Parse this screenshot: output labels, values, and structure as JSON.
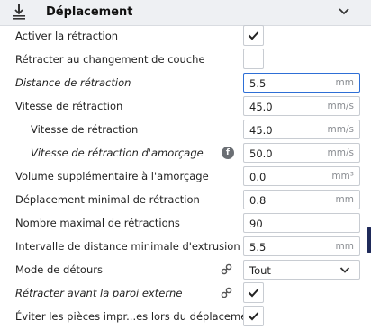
{
  "section": {
    "title": "Déplacement"
  },
  "rows": [
    {
      "label": "Activer la rétraction",
      "checked": true
    },
    {
      "label": "Rétracter au changement de couche",
      "checked": false
    },
    {
      "label": "Distance de rétraction",
      "value": "5.5",
      "unit": "mm"
    },
    {
      "label": "Vitesse de rétraction",
      "value": "45.0",
      "unit": "mm/s"
    },
    {
      "label": "Vitesse de rétraction",
      "value": "45.0",
      "unit": "mm/s"
    },
    {
      "label": "Vitesse de rétraction d'amorçage",
      "value": "50.0",
      "unit": "mm/s"
    },
    {
      "label": "Volume supplémentaire à l'amorçage",
      "value": "0.0",
      "unit": "mm³"
    },
    {
      "label": "Déplacement minimal de rétraction",
      "value": "0.8",
      "unit": "mm"
    },
    {
      "label": "Nombre maximal de rétractions",
      "value": "90",
      "unit": ""
    },
    {
      "label": "Intervalle de distance minimale d'extrusion",
      "value": "5.5",
      "unit": "mm"
    },
    {
      "label": "Mode de détours",
      "value": "Tout"
    },
    {
      "label": "Rétracter avant la paroi externe",
      "checked": true
    },
    {
      "label": "Éviter les pièces impr...es lors du déplacement",
      "checked": true
    }
  ]
}
